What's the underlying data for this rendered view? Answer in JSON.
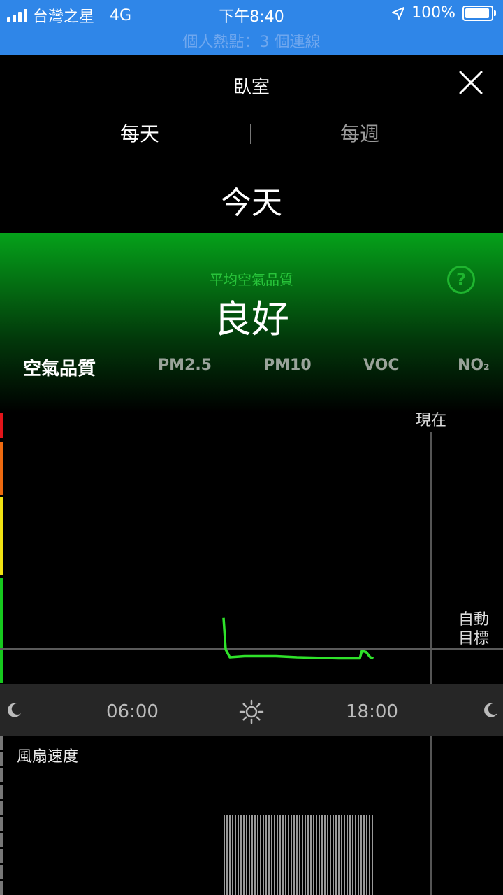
{
  "status_bar": {
    "carrier": "台灣之星",
    "network": "4G",
    "time": "下午8:40",
    "battery": "100%",
    "battery_level": 1.0,
    "hotspot": "個人熱點：3 個連線"
  },
  "header": {
    "title": "臥室",
    "close_icon": "close-icon"
  },
  "tabs": {
    "daily": "每天",
    "weekly": "每週",
    "active": "daily"
  },
  "period_title": "今天",
  "summary": {
    "label": "平均空氣品質",
    "value": "良好",
    "help_icon": "?"
  },
  "metrics": [
    {
      "label": "空氣品質",
      "active": true
    },
    {
      "label": "PM2.5",
      "active": false
    },
    {
      "label": "PM10",
      "active": false
    },
    {
      "label": "VOC",
      "active": false
    },
    {
      "label": "NO",
      "sub": "2",
      "active": false
    }
  ],
  "chart": {
    "now_label": "現在",
    "target_label_line1": "自動",
    "target_label_line2": "目標",
    "time_ticks": [
      "06:00",
      "18:00"
    ],
    "icons": [
      "moon-icon",
      "sun-icon",
      "moon-icon"
    ],
    "colors": {
      "line": "#2fe22a",
      "scale_red": "#e3141a",
      "scale_orange": "#ee6a10",
      "scale_yellow": "#f1e313",
      "scale_green": "#16c91e",
      "header_green": "#05a21a"
    }
  },
  "fan": {
    "label": "風扇速度"
  },
  "chart_data": {
    "type": "line",
    "x_unit": "hour of day",
    "xlim": [
      0,
      24
    ],
    "x": [
      13.5,
      13.6,
      13.8,
      14.5,
      16.0,
      17.0,
      18.0,
      19.0,
      20.0,
      20.1,
      20.3,
      20.5,
      20.65
    ],
    "y": [
      0.95,
      0.35,
      0.2,
      0.22,
      0.22,
      0.2,
      0.19,
      0.18,
      0.18,
      0.32,
      0.3,
      0.2,
      0.18
    ],
    "y_meaning": "relative air-quality level (0 = best, 1 = worst)",
    "fan_bars_x_range": [
      13.5,
      20.65
    ],
    "fan_level": 1.0
  }
}
